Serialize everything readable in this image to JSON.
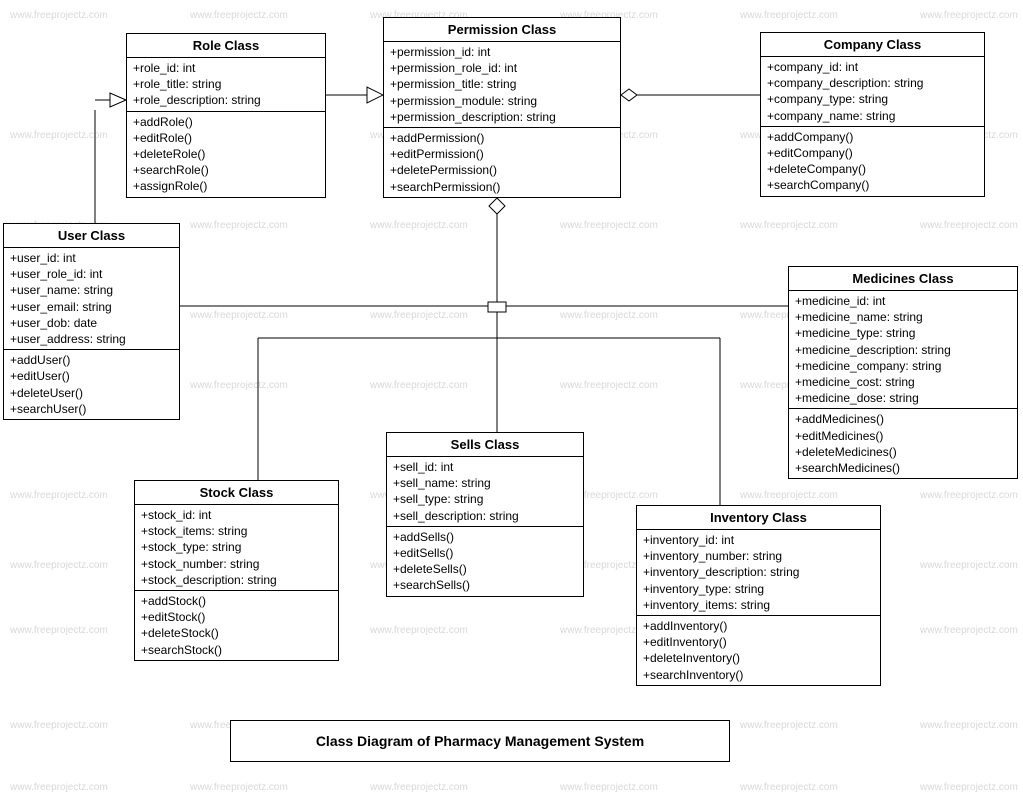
{
  "watermark": "www.freeprojectz.com",
  "title": "Class Diagram of Pharmacy Management System",
  "classes": {
    "role": {
      "name": "Role Class",
      "attrs": [
        "+role_id: int",
        "+role_title: string",
        "+role_description: string"
      ],
      "methods": [
        "+addRole()",
        "+editRole()",
        "+deleteRole()",
        "+searchRole()",
        "+assignRole()"
      ]
    },
    "permission": {
      "name": "Permission Class",
      "attrs": [
        "+permission_id: int",
        "+permission_role_id: int",
        "+permission_title: string",
        "+permission_module: string",
        "+permission_description: string"
      ],
      "methods": [
        "+addPermission()",
        "+editPermission()",
        "+deletePermission()",
        "+searchPermission()"
      ]
    },
    "company": {
      "name": "Company Class",
      "attrs": [
        "+company_id: int",
        "+company_description: string",
        "+company_type: string",
        "+company_name: string"
      ],
      "methods": [
        "+addCompany()",
        "+editCompany()",
        "+deleteCompany()",
        "+searchCompany()"
      ]
    },
    "user": {
      "name": "User Class",
      "attrs": [
        "+user_id: int",
        "+user_role_id: int",
        "+user_name: string",
        "+user_email: string",
        "+user_dob: date",
        "+user_address: string"
      ],
      "methods": [
        "+addUser()",
        "+editUser()",
        "+deleteUser()",
        "+searchUser()"
      ]
    },
    "medicines": {
      "name": "Medicines Class",
      "attrs": [
        "+medicine_id: int",
        "+medicine_name: string",
        "+medicine_type: string",
        "+medicine_description: string",
        "+medicine_company: string",
        "+medicine_cost: string",
        "+medicine_dose: string"
      ],
      "methods": [
        "+addMedicines()",
        "+editMedicines()",
        "+deleteMedicines()",
        "+searchMedicines()"
      ]
    },
    "sells": {
      "name": "Sells Class",
      "attrs": [
        "+sell_id: int",
        "+sell_name: string",
        "+sell_type: string",
        "+sell_description: string"
      ],
      "methods": [
        "+addSells()",
        "+editSells()",
        "+deleteSells()",
        "+searchSells()"
      ]
    },
    "stock": {
      "name": "Stock Class",
      "attrs": [
        "+stock_id: int",
        "+stock_items: string",
        "+stock_type: string",
        "+stock_number: string",
        "+stock_description: string"
      ],
      "methods": [
        "+addStock()",
        "+editStock()",
        "+deleteStock()",
        "+searchStock()"
      ]
    },
    "inventory": {
      "name": "Inventory Class",
      "attrs": [
        "+inventory_id: int",
        "+inventory_number: string",
        "+inventory_description: string",
        "+inventory_type: string",
        "+inventory_items: string"
      ],
      "methods": [
        "+addInventory()",
        "+editInventory()",
        "+deleteInventory()",
        "+searchInventory()"
      ]
    }
  }
}
